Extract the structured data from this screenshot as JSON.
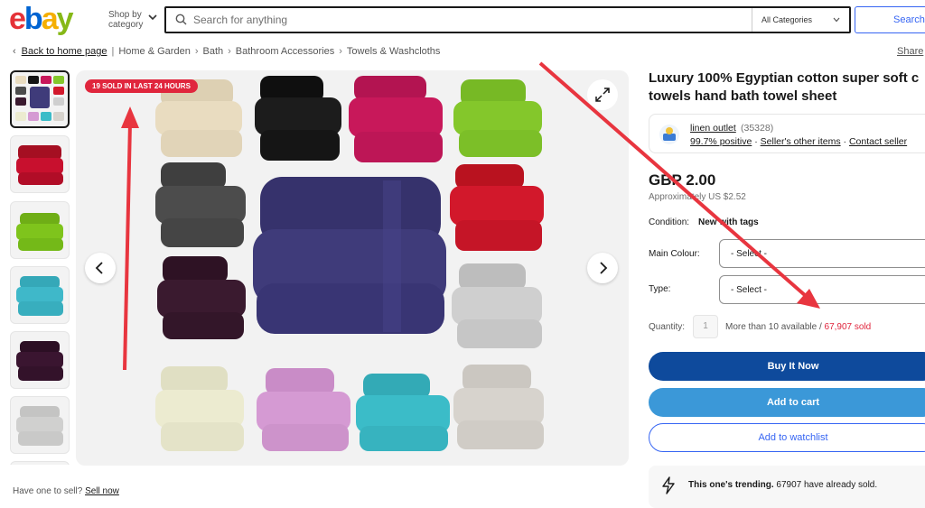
{
  "header": {
    "logo_letters": [
      "e",
      "b",
      "a",
      "y"
    ],
    "shop_by_line1": "Shop by",
    "shop_by_line2": "category",
    "search_placeholder": "Search for anything",
    "category_select": "All Categories",
    "search_button": "Search"
  },
  "breadcrumb": {
    "back": "Back to home page",
    "items": [
      "Home & Garden",
      "Bath",
      "Bathroom Accessories",
      "Towels & Washcloths"
    ],
    "share": "Share"
  },
  "gallery": {
    "badge": "19 SOLD IN LAST 24 HOURS",
    "thumbnail_colors": [
      "#c8102e",
      "#7fc41c",
      "#3fb8c9",
      "#3a1530",
      "#d0d0cf",
      "#e5e5e5"
    ],
    "towel_colors": [
      "#e9dcc0",
      "#151515",
      "#c8185a",
      "#84c72b",
      "#4c4c4c",
      "#d2182b",
      "#3a1a2f",
      "#3f3b7a",
      "#cfcfcf",
      "#ecebd0",
      "#d59ad3",
      "#3bbcc8",
      "#d7d3cd"
    ]
  },
  "listing": {
    "title_line1": "Luxury 100% Egyptian cotton super soft c",
    "title_line2": "towels hand bath towel sheet",
    "seller_name": "linen outlet",
    "seller_count": "(35328)",
    "seller_positive": "99.7% positive",
    "seller_other": "Seller's other items",
    "seller_contact": "Contact seller",
    "price": "GBP 2.00",
    "approx": "Approximately US $2.52",
    "condition_label": "Condition:",
    "condition_value": "New with tags",
    "colour_label": "Main Colour:",
    "colour_select": "- Select -",
    "type_label": "Type:",
    "type_select": "- Select -",
    "quantity_label": "Quantity:",
    "quantity_value": "1",
    "available": "More than 10 available",
    "available_sep": " / ",
    "sold": "67,907 sold",
    "buy_now": "Buy It Now",
    "add_to_cart": "Add to cart",
    "add_to_watchlist": "Add to watchlist",
    "trend_bold": "This one's trending.",
    "trend_rest": " 67907 have already sold.",
    "have_one": "Have one to sell?",
    "sell_now": "Sell now"
  },
  "colors": {
    "annotation_arrow": "#e8353f",
    "buy_button": "#0e4a9c",
    "cart_button": "#3b98d8",
    "link_blue": "#3665f3",
    "sold_red": "#e0263d"
  }
}
